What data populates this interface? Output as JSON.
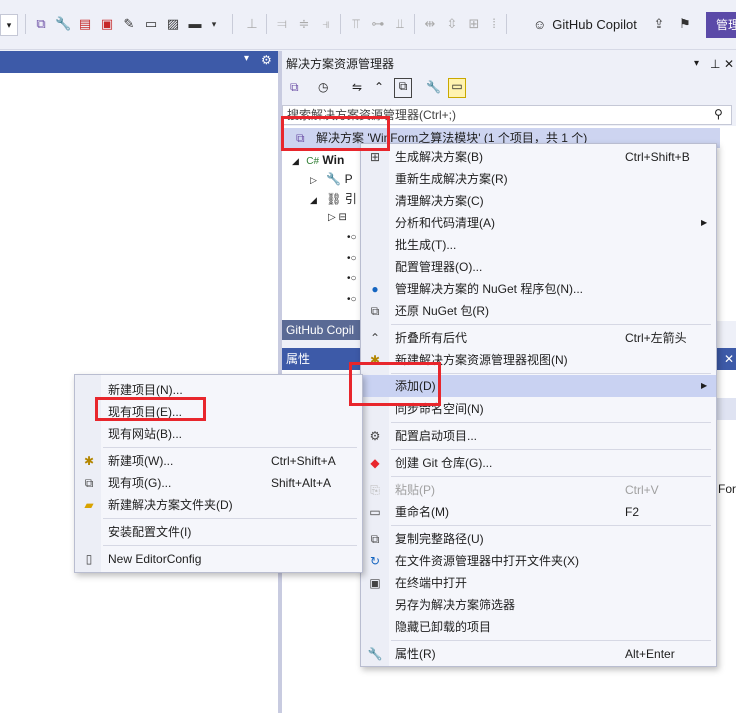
{
  "toolbar": {
    "copilot_label": "GitHub Copilot",
    "manage_label": "管理"
  },
  "solution_explorer": {
    "title": "解决方案资源管理器",
    "search_placeholder": "搜索解决方案资源管理器(Ctrl+;)",
    "solution_label": "解决方案 'WinForm之算法模块' (1 个项目，共 1 个)",
    "tree": [
      {
        "label": "Win"
      },
      {
        "label": "P"
      },
      {
        "label": "引"
      }
    ]
  },
  "copilot_tab": "GitHub Copil",
  "properties": {
    "title": "属性",
    "partial_text": "For"
  },
  "context_menu": {
    "items": [
      {
        "label": "生成解决方案(B)",
        "shortcut": "Ctrl+Shift+B",
        "icon": "build-icon"
      },
      {
        "label": "重新生成解决方案(R)",
        "shortcut": ""
      },
      {
        "label": "清理解决方案(C)",
        "shortcut": ""
      },
      {
        "label": "分析和代码清理(A)",
        "shortcut": "",
        "submenu": true
      },
      {
        "label": "批生成(T)...",
        "shortcut": ""
      },
      {
        "label": "配置管理器(O)...",
        "shortcut": ""
      },
      {
        "label": "管理解决方案的 NuGet 程序包(N)...",
        "shortcut": "",
        "icon": "nuget-icon"
      },
      {
        "label": "还原 NuGet 包(R)",
        "shortcut": "",
        "icon": "restore-icon"
      },
      {
        "label": "折叠所有后代",
        "shortcut": "Ctrl+左箭头",
        "icon": "collapse-icon"
      },
      {
        "label": "新建解决方案资源管理器视图(N)",
        "shortcut": ""
      },
      {
        "label": "添加(D)",
        "shortcut": "",
        "submenu": true
      },
      {
        "label": "同步命名空间(N)",
        "shortcut": ""
      },
      {
        "label": "配置启动项目...",
        "shortcut": "",
        "icon": "gear-icon"
      },
      {
        "label": "创建 Git 仓库(G)...",
        "shortcut": "",
        "icon": "git-icon"
      },
      {
        "label": "粘贴(P)",
        "shortcut": "Ctrl+V",
        "icon": "paste-icon",
        "disabled": true
      },
      {
        "label": "重命名(M)",
        "shortcut": "F2",
        "icon": "rename-icon"
      },
      {
        "label": "复制完整路径(U)",
        "shortcut": "",
        "icon": "copy-path-icon"
      },
      {
        "label": "在文件资源管理器中打开文件夹(X)",
        "shortcut": "",
        "icon": "open-folder-icon"
      },
      {
        "label": "在终端中打开",
        "shortcut": "",
        "icon": "terminal-icon"
      },
      {
        "label": "另存为解决方案筛选器",
        "shortcut": ""
      },
      {
        "label": "隐藏已卸载的项目",
        "shortcut": ""
      },
      {
        "label": "属性(R)",
        "shortcut": "Alt+Enter",
        "icon": "wrench-icon"
      }
    ]
  },
  "add_submenu": {
    "items": [
      {
        "label": "新建项目(N)...",
        "shortcut": ""
      },
      {
        "label": "现有项目(E)...",
        "shortcut": ""
      },
      {
        "label": "现有网站(B)...",
        "shortcut": ""
      },
      {
        "label": "新建项(W)...",
        "shortcut": "Ctrl+Shift+A",
        "icon": "new-item-icon"
      },
      {
        "label": "现有项(G)...",
        "shortcut": "Shift+Alt+A",
        "icon": "existing-item-icon"
      },
      {
        "label": "新建解决方案文件夹(D)",
        "shortcut": "",
        "icon": "folder-icon"
      },
      {
        "label": "安装配置文件(I)",
        "shortcut": ""
      },
      {
        "label": "New EditorConfig",
        "shortcut": "",
        "icon": "file-icon"
      }
    ]
  },
  "colors": {
    "accent": "#5b4aa8",
    "highlight": "#e8262c",
    "selected": "#cdd4f0"
  }
}
